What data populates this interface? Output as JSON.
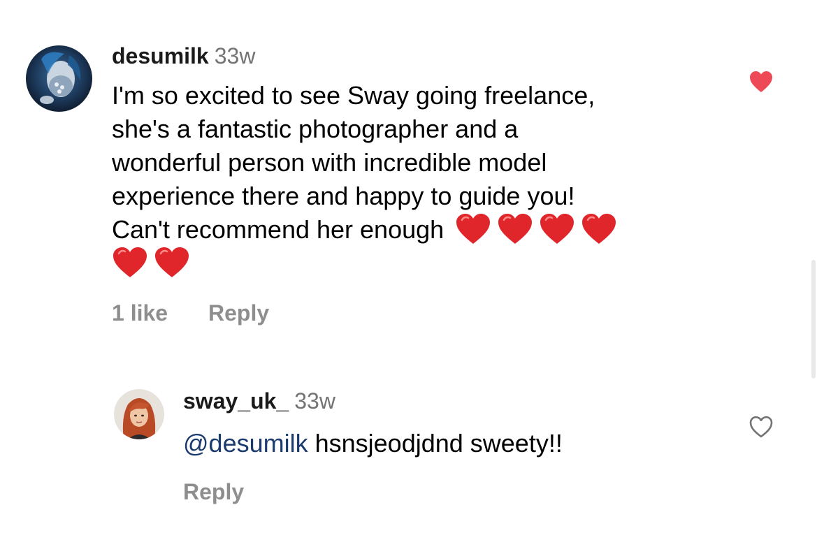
{
  "main_comment": {
    "username": "desumilk",
    "timestamp": "33w",
    "text_lines": [
      "I'm so excited to see Sway going freelance,",
      "she's a fantastic photographer and a",
      "wonderful person with incredible model",
      "experience there and happy to guide you!",
      "Can't recommend her enough"
    ],
    "emoji_count": 6,
    "emoji": "red-heart",
    "likes_label": "1 like",
    "reply_label": "Reply",
    "liked": true,
    "like_color": "#ed4956"
  },
  "reply_comment": {
    "username": "sway_uk_",
    "timestamp": "33w",
    "mention": "@desumilk",
    "text": "hsnsjeodjdnd sweety!!",
    "reply_label": "Reply",
    "liked": false
  },
  "colors": {
    "mention": "#1b3b6f",
    "secondary_text": "#8e8e8e",
    "timestamp": "#737373",
    "heart_filled": "#ed4956"
  }
}
